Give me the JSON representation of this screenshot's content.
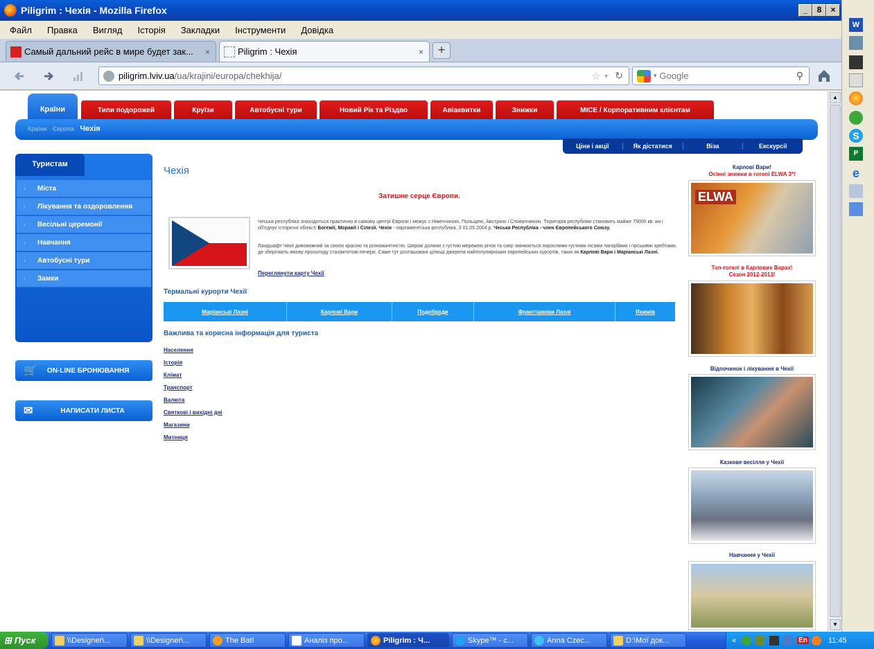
{
  "window": {
    "title": "Piligrim : Чехія - Mozilla Firefox",
    "min": "_",
    "max": "8",
    "close": "×"
  },
  "menu": [
    "Файл",
    "Правка",
    "Вигляд",
    "Історія",
    "Закладки",
    "Інструменти",
    "Довідка"
  ],
  "tabs": [
    {
      "label": "Самый дальний рейс в мире будет зак...",
      "close": "×"
    },
    {
      "label": "Piligrim : Чехія",
      "close": "×"
    }
  ],
  "newtab": "+",
  "nav": {
    "url_domain": "piligrim.lviv.ua",
    "url_path": "/ua/krajini/europa/chekhija/",
    "search_placeholder": "Google"
  },
  "site": {
    "main_nav": [
      "Країни",
      "Типи подорожей",
      "Круїзи",
      "Автобусні тури",
      "Новий Рік та Різдво",
      "Авіаквитки",
      "Знижки",
      "MICE / Корпоративним клієнтам"
    ],
    "breadcrumb": [
      "Країни",
      "Європа",
      "Чехія"
    ],
    "sub_nav": [
      "Ціни і акції",
      "Як дістатися",
      "Віза",
      "Екскурсії"
    ],
    "sidebar": {
      "header": "Туристам",
      "items": [
        "Міста",
        "Лікування та оздоровлення",
        "Весільні церемонії",
        "Навчання",
        "Автобусні тури",
        "Замки"
      ],
      "booking": "ON-LINE БРОНЮВАННЯ",
      "write": "НАПИСАТИ ЛИСТА"
    },
    "page_title": "Чехія",
    "tagline": "Затишне серце Європи.",
    "para1_a": "Чеська республіка знаходиться практично в самому центрі Європи і межує з Німеччиною, Польщею, Австрією і Словаччиною. Територія республіки становить майже 79000 кв. км і об'єднує історичні області ",
    "para1_b": "Богемії, Моравії і Сілезії. Чехія",
    "para1_c": " - парламентська республіка. З 01.05.2004 р. ",
    "para1_d": "Чеська Республіка - член Європейського Союзу.",
    "para2_a": "Ландшафт Чехії дивовижний за своєю красою та різноманітністю. Широкі долини з густою мережею річок та озер змінюються порослими густими лісами пагорбами і гірськими хребтами, де зберігають вікову прохолоду сталактитові печери. Саме тут розташовані цілющі джерела найпопулярніших європейських курортів, таких як ",
    "para2_b": "Карлові Вари і Маріанські Лазні.",
    "map_link": "Переглянути карту Чехії",
    "resorts_title": "Термальні курорти Чехії",
    "resorts": [
      "Маріанські Лазні",
      "Карлові Вари",
      "Подебради",
      "Франтішкови Лазні",
      "Яхимів"
    ],
    "info_title": "Важлива та корисна інформація для туриста",
    "info_links": [
      "Населення",
      "Історія",
      "Клімат",
      "Транспорт",
      "Валюта",
      "Святкові і вихідні дні",
      "Магазини",
      "Митниця"
    ],
    "promos": [
      {
        "title": "Карлові Вари!",
        "subtitle": "Осінні знижки в готелі ELWA 3*!",
        "img_text": "ELWA"
      },
      {
        "title": "Топ-готелі в Карлових Варах!",
        "subtitle": "Сезон 2012-2013!"
      },
      {
        "title": "Відпочинок і лікування в Чехії"
      },
      {
        "title": "Казкове весілля у Чехії"
      },
      {
        "title": "Навчання у Чехії"
      }
    ]
  },
  "taskbar": {
    "start": "Пуск",
    "items": [
      "\\\\Designer\\...",
      "\\\\Designer\\...",
      "The Bat!",
      "Аналіз про...",
      "Piligrim : Ч...",
      "Skype™ - c...",
      "Anna Czec...",
      "D:\\Мої док..."
    ],
    "tray_chevron": "«",
    "lang": "En",
    "time": "11:45"
  }
}
